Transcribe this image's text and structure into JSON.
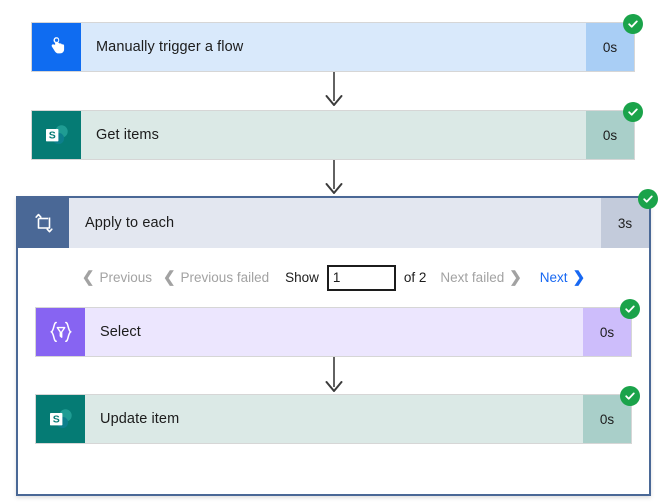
{
  "flow": {
    "steps": [
      {
        "id": "manually-trigger-a-flow",
        "title": "Manually trigger a flow",
        "duration": "0s",
        "status": "succeeded",
        "icon": "hand-tap-icon",
        "icon_color": "#0f6cf1",
        "card_color": "#d9e9fb",
        "duration_color": "#a9cef5"
      },
      {
        "id": "get-items",
        "title": "Get items",
        "duration": "0s",
        "status": "succeeded",
        "icon": "sharepoint-icon",
        "icon_color": "#057b74",
        "card_color": "#dbe9e6",
        "duration_color": "#a9cfc9"
      }
    ],
    "scope": {
      "id": "apply-to-each",
      "title": "Apply to each",
      "duration": "3s",
      "status": "succeeded",
      "icon": "loop-icon",
      "icon_color": "#4a6896",
      "card_color": "#e3e7f0",
      "duration_color": "#c3cbdb",
      "border_color": "#4a6896",
      "pagination": {
        "previous_label": "Previous",
        "previous_failed_label": "Previous failed",
        "show_label": "Show",
        "page_value": "1",
        "page_placeholder": "",
        "of_label": "of 2",
        "next_failed_label": "Next failed",
        "next_label": "Next",
        "prev_chevron": "❮",
        "next_chevron": "❯",
        "disabled_color": "#a2a2a2",
        "active_color": "#1868f2"
      },
      "steps": [
        {
          "id": "select",
          "title": "Select",
          "duration": "0s",
          "status": "succeeded",
          "icon": "data-operation-select-icon",
          "icon_color": "#8764f2",
          "card_color": "#ece6fe",
          "duration_color": "#cdbdfb"
        },
        {
          "id": "update-item",
          "title": "Update item",
          "duration": "0s",
          "status": "succeeded",
          "icon": "sharepoint-icon",
          "icon_color": "#057b74",
          "card_color": "#dbe9e6",
          "duration_color": "#a9cfc9"
        }
      ]
    },
    "status_badge": {
      "icon": "check-circle-icon",
      "color": "#1aa34a",
      "glyph": "✓"
    },
    "connector": {
      "icon": "arrow-down-icon",
      "color": "#3b3b3b"
    }
  }
}
